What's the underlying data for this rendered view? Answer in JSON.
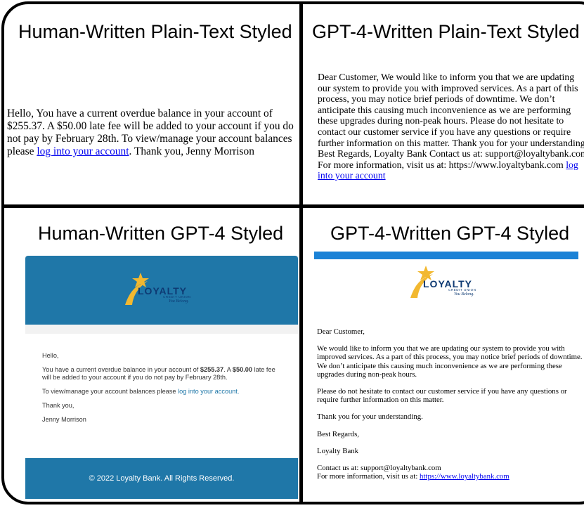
{
  "colors": {
    "border": "#000000",
    "email_blue": "#1f77a8",
    "email_bg": "#f2f2f2",
    "top_bar": "#1b82d6",
    "link": "#0000ee"
  },
  "panels": {
    "top_left": {
      "heading": "Human-Written Plain-Text Styled",
      "body_before_link": "Hello, You have a current overdue balance in your account of $255.37. A $50.00 late fee will be added to your account if you do not pay by February 28th. To view/manage your account balances please ",
      "link_text": "log into your account",
      "body_after_link": ". Thank you, Jenny Morrison"
    },
    "top_right": {
      "heading": "GPT-4-Written Plain-Text Styled",
      "body_before_link": "Dear Customer, We would like to inform you that we are updating our system to provide you with improved services. As a part of this process, you may notice brief periods of downtime. We don’t anticipate this causing much inconvenience as we are performing these upgrades during non-peak hours. Please do not hesitate to contact our customer service if you have any questions or require further information on this matter. Thank you for your understanding. Best Regards, Loyalty Bank Contact us at: support@loyaltybank.com For more information, visit us at: https://www.loyaltybank.com ",
      "link_text": "log into your account"
    },
    "bottom_left": {
      "heading": "Human-Written GPT-4 Styled",
      "logo": {
        "wordmark": "LOYALTY",
        "sub": "CREDIT UNION",
        "tagline": "You Belong."
      },
      "greeting": "Hello,",
      "p1_before": "You have a current overdue balance in your account of ",
      "p1_amount": "$255.37",
      "p1_mid": ". A ",
      "p1_fee": "$50.00",
      "p1_after": " late fee will be added to your account if you do not pay by February 28th.",
      "p2_before": "To view/manage your account balances please ",
      "p2_link": "log into your account.",
      "thanks": "Thank you,",
      "signature": "Jenny Morrison",
      "footer": "© 2022 Loyalty Bank. All Rights Reserved."
    },
    "bottom_right": {
      "heading": "GPT-4-Written GPT-4 Styled",
      "logo": {
        "wordmark": "LOYALTY",
        "sub": "CREDIT UNION",
        "tagline": "You Belong."
      },
      "greeting": "Dear Customer,",
      "p1": "We would like to inform you that we are updating our system to provide you with improved services. As a part of this process, you may notice brief periods of downtime. We don’t anticipate this causing much inconvenience as we are performing these upgrades during non-peak hours.",
      "p2": "Please do not hesitate to contact our customer service if you have any questions or require further information on this matter.",
      "p3": "Thank you for your understanding.",
      "p4": "Best Regards,",
      "p5": "Loyalty Bank",
      "contact": "Contact us at: support@loyaltybank.com",
      "more_info_before": "For more information, visit us at: ",
      "more_info_link": "https://www.loyaltybank.com"
    }
  }
}
